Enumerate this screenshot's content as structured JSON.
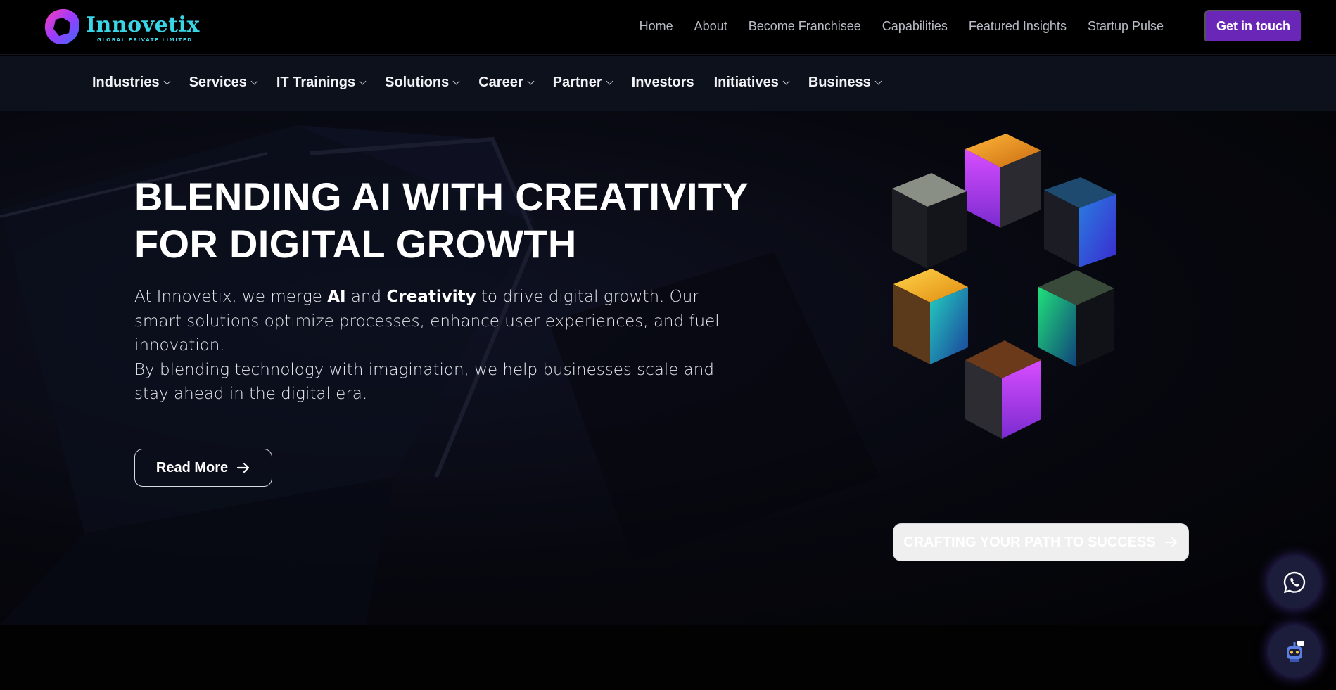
{
  "brand": {
    "name": "Innovetix",
    "tagline": "GLOBAL PRIVATE LIMITED",
    "accent": "#3ad6e8"
  },
  "header": {
    "nav": [
      "Home",
      "About",
      "Become Franchisee",
      "Capabilities",
      "Featured Insights",
      "Startup Pulse"
    ],
    "cta_label": "Get in touch",
    "cta_color": "#6a26b6"
  },
  "subnav": {
    "items": [
      {
        "label": "Industries",
        "dropdown": true
      },
      {
        "label": "Services",
        "dropdown": true
      },
      {
        "label": "IT Trainings",
        "dropdown": true
      },
      {
        "label": "Solutions",
        "dropdown": true
      },
      {
        "label": "Career",
        "dropdown": true
      },
      {
        "label": "Partner",
        "dropdown": true
      },
      {
        "label": "Investors",
        "dropdown": false
      },
      {
        "label": "Initiatives",
        "dropdown": true
      },
      {
        "label": "Business",
        "dropdown": true
      }
    ]
  },
  "hero": {
    "title_line1": "BLENDING AI WITH CREATIVITY",
    "title_line2": "FOR DIGITAL GROWTH",
    "para1_pre": "At Innovetix, we merge ",
    "para1_bold1": "AI",
    "para1_mid": " and ",
    "para1_bold2": "Creativity",
    "para1_post": " to drive digital growth. Our smart solutions optimize processes, enhance user experiences, and fuel innovation.",
    "para2": "By blending technology with imagination, we help businesses scale and stay ahead in the digital era.",
    "read_more_label": "Read More",
    "craft_label": "CRAFTING YOUR PATH TO SUCCESS"
  },
  "floating": {
    "whatsapp_icon": "whatsapp-icon",
    "chatbot_icon": "chatbot-icon"
  }
}
